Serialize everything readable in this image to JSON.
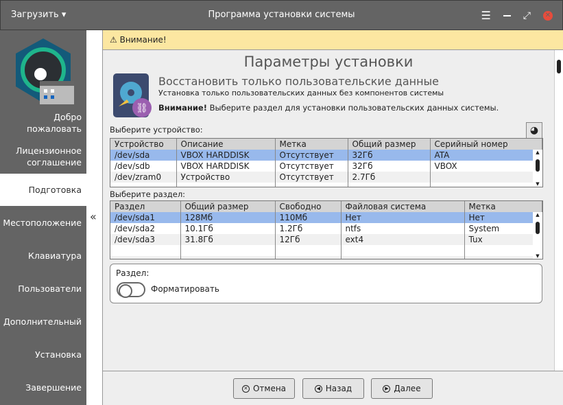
{
  "titlebar": {
    "menu_label": "Загрузить",
    "title": "Программа установки системы"
  },
  "sidebar": {
    "items": [
      {
        "label": "Добро пожаловать"
      },
      {
        "label": "Лицензионное соглашение"
      },
      {
        "label": "Подготовка"
      },
      {
        "label": "Местоположение"
      },
      {
        "label": "Клавиатура"
      },
      {
        "label": "Пользователи"
      },
      {
        "label": "Дополнительный"
      },
      {
        "label": "Установка"
      },
      {
        "label": "Завершение"
      }
    ],
    "collapse_label": "«"
  },
  "warning": {
    "text": "Внимание!"
  },
  "main": {
    "title": "Параметры установки",
    "mode_title": "Восстановить только пользовательские данные",
    "mode_subtitle": "Установка только пользовательских данных без компонентов системы",
    "note_bold": "Внимание!",
    "note_text": " Выберите раздел для установки пользовательских данных системы.",
    "device_label": "Выберите устройство:",
    "device_headers": [
      "Устройство",
      "Описание",
      "Метка",
      "Общий размер",
      "Серийный номер"
    ],
    "devices": [
      [
        "/dev/sda",
        "VBOX HARDDISK",
        "Отсутствует",
        "32Гб",
        "ATA"
      ],
      [
        "/dev/sdb",
        "VBOX HARDDISK",
        "Отсутствует",
        "32Гб",
        "VBOX"
      ],
      [
        "/dev/zram0",
        "Устройство",
        "Отсутствует",
        "2.7Гб",
        ""
      ]
    ],
    "partition_label": "Выберите раздел:",
    "partition_headers": [
      "Раздел",
      "Общий размер",
      "Свободно",
      "Файловая система",
      "Метка"
    ],
    "partitions": [
      [
        "/dev/sda1",
        "128Мб",
        "110Мб",
        "Нет",
        "Нет"
      ],
      [
        "/dev/sda2",
        "10.1Гб",
        "1.2Гб",
        "ntfs",
        "System"
      ],
      [
        "/dev/sda3",
        "31.8Гб",
        "12Гб",
        "ext4",
        "Tux"
      ]
    ],
    "part_box_label": "Раздел:",
    "format_label": "Форматировать",
    "format_on": false
  },
  "footer": {
    "cancel": "Отмена",
    "back": "Назад",
    "next": "Далее"
  }
}
